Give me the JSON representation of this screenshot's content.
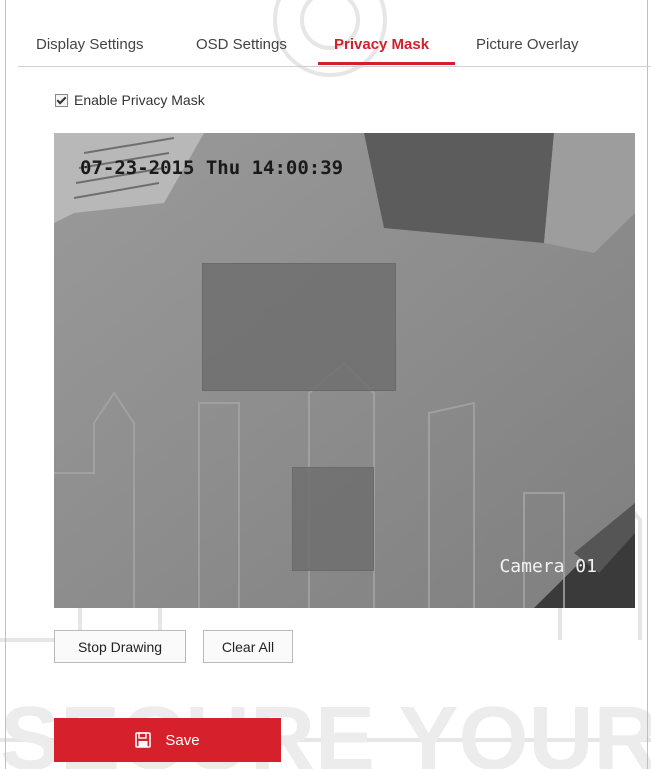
{
  "tabs": [
    {
      "label": "Display Settings",
      "active": false
    },
    {
      "label": "OSD Settings",
      "active": false
    },
    {
      "label": "Privacy Mask",
      "active": true
    },
    {
      "label": "Picture Overlay",
      "active": false
    }
  ],
  "privacy_mask": {
    "enable_label": "Enable Privacy Mask",
    "enabled": true
  },
  "video": {
    "osd_datetime": "07-23-2015 Thu 14:00:39",
    "osd_camera_name": "Camera 01"
  },
  "buttons": {
    "stop_drawing": "Stop Drawing",
    "clear_all": "Clear All",
    "save": "Save"
  },
  "colors": {
    "accent": "#d6202b",
    "active_tab": "#d11f2b"
  },
  "icons": {
    "save": "floppy-disk-icon",
    "checkbox": "checkmark"
  }
}
